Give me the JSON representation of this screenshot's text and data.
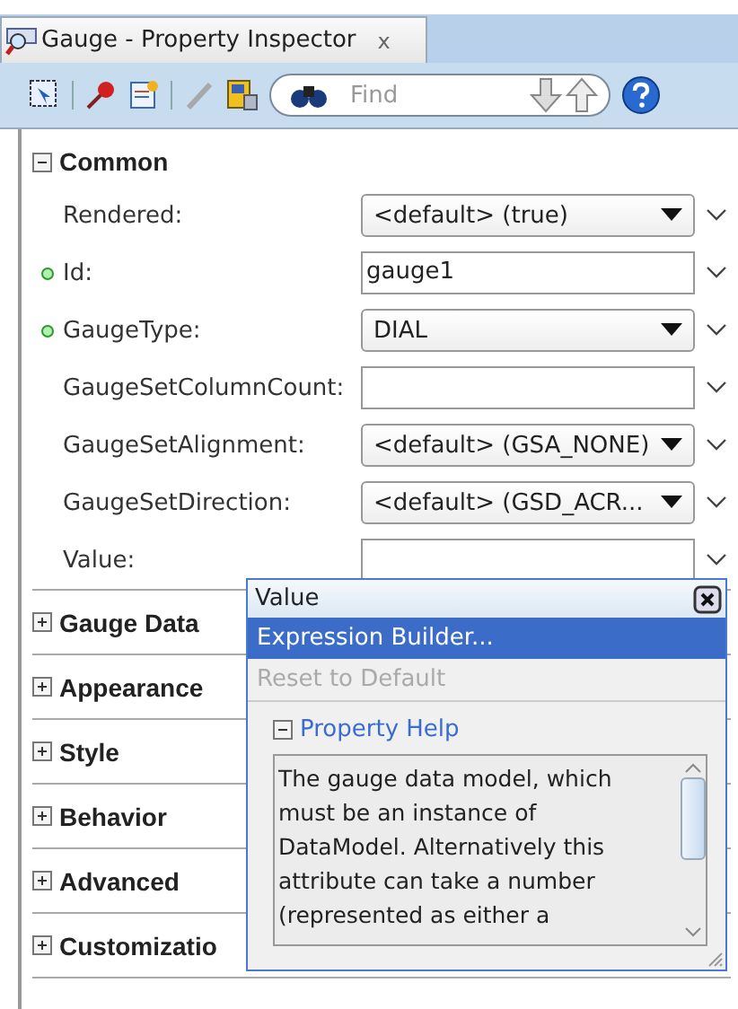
{
  "tab": {
    "title": "Gauge - Property Inspector",
    "close": "x"
  },
  "toolbar": {
    "find": {
      "placeholder": "Find"
    }
  },
  "sections": [
    {
      "title": "Common",
      "expanded": true,
      "properties": [
        {
          "label": "Rendered:",
          "required": false,
          "kind": "select",
          "value": "<default> (true)"
        },
        {
          "label": "Id:",
          "required": true,
          "kind": "text",
          "value": "gauge1"
        },
        {
          "label": "GaugeType:",
          "required": true,
          "kind": "select",
          "value": "DIAL"
        },
        {
          "label": "GaugeSetColumnCount:",
          "required": false,
          "kind": "text"
        },
        {
          "label": "GaugeSetAlignment:",
          "required": false,
          "kind": "select",
          "value": "<default> (GSA_NONE)"
        },
        {
          "label": "GaugeSetDirection:",
          "required": false,
          "kind": "select",
          "value": "<default> (GSD_ACR..."
        },
        {
          "label": "Value:",
          "required": false,
          "kind": "text"
        }
      ]
    },
    {
      "title": "Gauge Data",
      "expanded": false
    },
    {
      "title": "Appearance",
      "expanded": false
    },
    {
      "title": "Style",
      "expanded": false
    },
    {
      "title": "Behavior",
      "expanded": false
    },
    {
      "title": "Advanced",
      "expanded": false
    },
    {
      "title": "Customizatio",
      "expanded": false
    }
  ],
  "popup": {
    "title": "Value",
    "menu": [
      {
        "label": "Expression Builder...",
        "selected": true,
        "disabled": false
      },
      {
        "label": "Reset to Default",
        "selected": false,
        "disabled": true
      }
    ],
    "help": {
      "title": "Property Help",
      "expanded": true,
      "lines": [
        "The gauge data model, which",
        "must be an instance of",
        "DataModel. Alternatively this",
        "attribute can take a number",
        "(represented as either a"
      ]
    }
  }
}
